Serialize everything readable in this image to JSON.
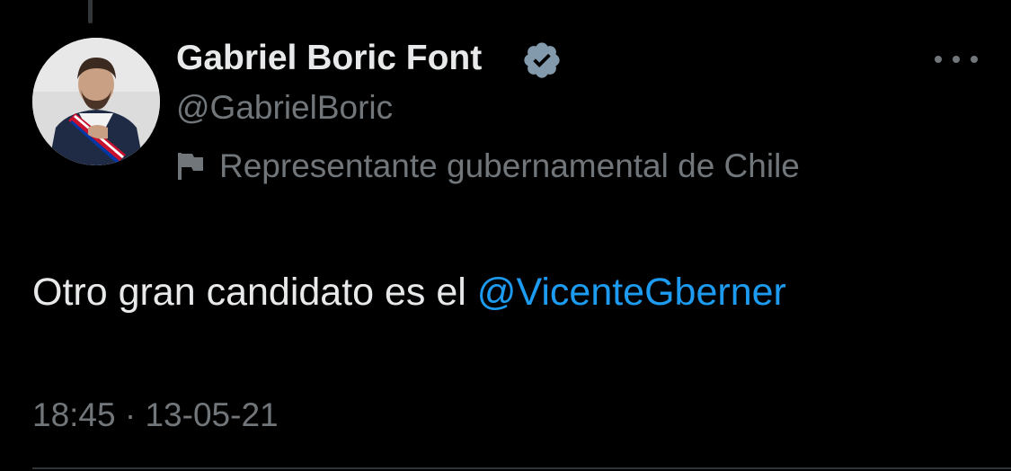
{
  "tweet": {
    "author": {
      "display_name": "Gabriel Boric Font",
      "handle": "@GabrielBoric",
      "verified": true,
      "verified_color": "#829aab",
      "affiliation": "Representante gubernamental de Chile",
      "affiliation_icon": "flag-icon",
      "avatar_icon": "profile-avatar"
    },
    "text_before_mention": "Otro gran candidato es el ",
    "mention": "@VicenteGberner",
    "time": "18:45",
    "separator": "·",
    "date": "13-05-21",
    "more_icon": "more-options-icon"
  },
  "colors": {
    "background": "#000000",
    "primary_text": "#e7e9ea",
    "secondary_text": "#71767b",
    "link": "#1d9bf0",
    "divider": "#2f3336"
  }
}
